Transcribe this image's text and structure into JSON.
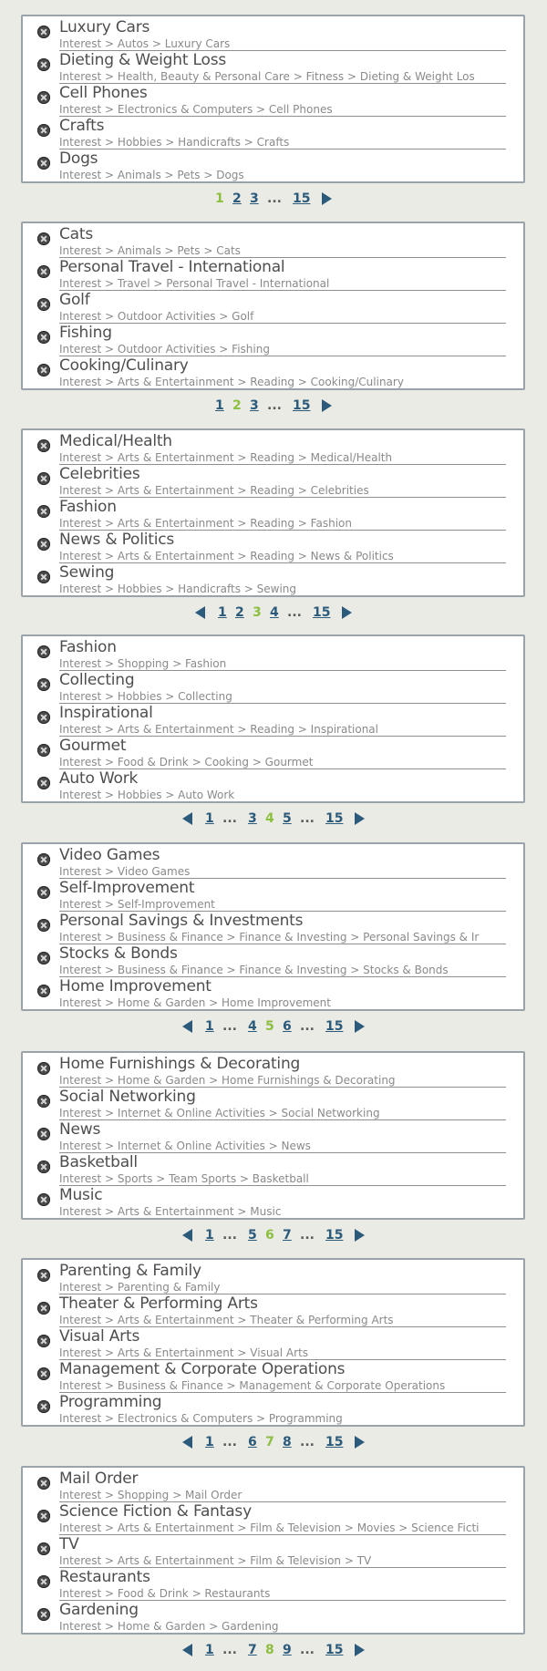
{
  "groups": [
    {
      "items": [
        {
          "title": "Luxury Cars",
          "path": "Interest > Autos > Luxury Cars"
        },
        {
          "title": "Dieting & Weight Loss",
          "path": "Interest > Health, Beauty & Personal Care > Fitness > Dieting & Weight Los"
        },
        {
          "title": "Cell Phones",
          "path": "Interest > Electronics & Computers > Cell Phones"
        },
        {
          "title": "Crafts",
          "path": "Interest > Hobbies > Handicrafts > Crafts"
        },
        {
          "title": "Dogs",
          "path": "Interest > Animals > Pets > Dogs"
        }
      ],
      "pager": {
        "prev": false,
        "pages": [
          "1",
          "2",
          "3",
          "...",
          "15"
        ],
        "current": "1",
        "next": true
      }
    },
    {
      "items": [
        {
          "title": "Cats",
          "path": "Interest > Animals > Pets > Cats"
        },
        {
          "title": "Personal Travel - International",
          "path": "Interest > Travel > Personal Travel - International"
        },
        {
          "title": "Golf",
          "path": "Interest > Outdoor Activities > Golf"
        },
        {
          "title": "Fishing",
          "path": "Interest > Outdoor Activities > Fishing"
        },
        {
          "title": "Cooking/Culinary",
          "path": "Interest > Arts & Entertainment > Reading > Cooking/Culinary"
        }
      ],
      "pager": {
        "prev": false,
        "pages": [
          "1",
          "2",
          "3",
          "...",
          "15"
        ],
        "current": "2",
        "next": true
      }
    },
    {
      "items": [
        {
          "title": "Medical/Health",
          "path": "Interest > Arts & Entertainment > Reading > Medical/Health"
        },
        {
          "title": "Celebrities",
          "path": "Interest > Arts & Entertainment > Reading > Celebrities"
        },
        {
          "title": "Fashion",
          "path": "Interest > Arts & Entertainment > Reading > Fashion"
        },
        {
          "title": "News & Politics",
          "path": "Interest > Arts & Entertainment > Reading > News & Politics"
        },
        {
          "title": "Sewing",
          "path": "Interest > Hobbies > Handicrafts > Sewing"
        }
      ],
      "pager": {
        "prev": true,
        "pages": [
          "1",
          "2",
          "3",
          "4",
          "...",
          "15"
        ],
        "current": "3",
        "next": true
      }
    },
    {
      "items": [
        {
          "title": "Fashion",
          "path": "Interest > Shopping > Fashion"
        },
        {
          "title": "Collecting",
          "path": "Interest > Hobbies > Collecting"
        },
        {
          "title": "Inspirational",
          "path": "Interest > Arts & Entertainment > Reading > Inspirational"
        },
        {
          "title": "Gourmet",
          "path": "Interest > Food & Drink > Cooking > Gourmet"
        },
        {
          "title": "Auto Work",
          "path": "Interest > Hobbies > Auto Work"
        }
      ],
      "pager": {
        "prev": true,
        "pages": [
          "1",
          "...",
          "3",
          "4",
          "5",
          "...",
          "15"
        ],
        "current": "4",
        "next": true
      }
    },
    {
      "items": [
        {
          "title": "Video Games",
          "path": "Interest > Video Games"
        },
        {
          "title": "Self-Improvement",
          "path": "Interest > Self-Improvement"
        },
        {
          "title": "Personal Savings & Investments",
          "path": "Interest > Business & Finance > Finance & Investing > Personal Savings & Ir"
        },
        {
          "title": "Stocks & Bonds",
          "path": "Interest > Business & Finance > Finance & Investing > Stocks & Bonds"
        },
        {
          "title": "Home Improvement",
          "path": "Interest > Home & Garden > Home Improvement"
        }
      ],
      "pager": {
        "prev": true,
        "pages": [
          "1",
          "...",
          "4",
          "5",
          "6",
          "...",
          "15"
        ],
        "current": "5",
        "next": true
      }
    },
    {
      "items": [
        {
          "title": "Home Furnishings & Decorating",
          "path": "Interest > Home & Garden > Home Furnishings & Decorating"
        },
        {
          "title": "Social Networking",
          "path": "Interest > Internet & Online Activities > Social Networking"
        },
        {
          "title": "News",
          "path": "Interest > Internet & Online Activities > News"
        },
        {
          "title": "Basketball",
          "path": "Interest > Sports > Team Sports > Basketball"
        },
        {
          "title": "Music",
          "path": "Interest > Arts & Entertainment > Music"
        }
      ],
      "pager": {
        "prev": true,
        "pages": [
          "1",
          "...",
          "5",
          "6",
          "7",
          "...",
          "15"
        ],
        "current": "6",
        "next": true
      }
    },
    {
      "items": [
        {
          "title": "Parenting & Family",
          "path": "Interest > Parenting & Family"
        },
        {
          "title": "Theater & Performing Arts",
          "path": "Interest > Arts & Entertainment > Theater & Performing Arts"
        },
        {
          "title": "Visual Arts",
          "path": "Interest > Arts & Entertainment > Visual Arts"
        },
        {
          "title": "Management & Corporate Operations",
          "path": "Interest > Business & Finance > Management & Corporate Operations"
        },
        {
          "title": "Programming",
          "path": "Interest > Electronics & Computers > Programming"
        }
      ],
      "pager": {
        "prev": true,
        "pages": [
          "1",
          "...",
          "6",
          "7",
          "8",
          "...",
          "15"
        ],
        "current": "7",
        "next": true
      }
    },
    {
      "items": [
        {
          "title": "Mail Order",
          "path": "Interest > Shopping > Mail Order"
        },
        {
          "title": "Science Fiction & Fantasy",
          "path": "Interest > Arts & Entertainment > Film & Television > Movies > Science Ficti"
        },
        {
          "title": "TV",
          "path": "Interest > Arts & Entertainment > Film & Television > TV"
        },
        {
          "title": "Restaurants",
          "path": "Interest > Food & Drink > Restaurants"
        },
        {
          "title": "Gardening",
          "path": "Interest > Home & Garden > Gardening"
        }
      ],
      "pager": {
        "prev": true,
        "pages": [
          "1",
          "...",
          "7",
          "8",
          "9",
          "...",
          "15"
        ],
        "current": "8",
        "next": true
      }
    }
  ]
}
